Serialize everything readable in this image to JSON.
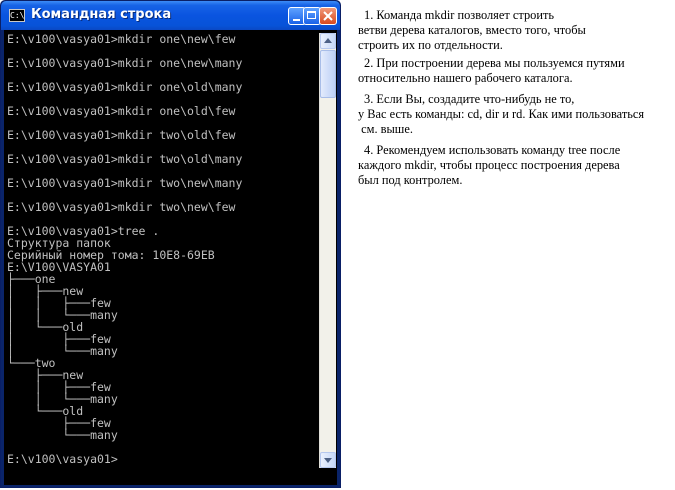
{
  "window": {
    "title": "Командная строка",
    "icon_label": "C:\\",
    "icon": "console-app-icon",
    "title_bar_color": "#0a54e0"
  },
  "console": {
    "text_color": "#c0c0c0",
    "background": "#000000",
    "lines": [
      "E:\\v100\\vasya01>mkdir one\\new\\few",
      "",
      "E:\\v100\\vasya01>mkdir one\\new\\many",
      "",
      "E:\\v100\\vasya01>mkdir one\\old\\many",
      "",
      "E:\\v100\\vasya01>mkdir one\\old\\few",
      "",
      "E:\\v100\\vasya01>mkdir two\\old\\few",
      "",
      "E:\\v100\\vasya01>mkdir two\\old\\many",
      "",
      "E:\\v100\\vasya01>mkdir two\\new\\many",
      "",
      "E:\\v100\\vasya01>mkdir two\\new\\few",
      "",
      "E:\\v100\\vasya01>tree .",
      "Структура папок",
      "Серийный номер тома: 10E8-69EB",
      "E:\\V100\\VASYA01",
      "├───one",
      "│   ├───new",
      "│   │   ├───few",
      "│   │   └───many",
      "│   └───old",
      "│       ├───few",
      "│       └───many",
      "└───two",
      "    ├───new",
      "    │   ├───few",
      "    │   └───many",
      "    └───old",
      "        ├───few",
      "        └───many",
      "",
      "E:\\v100\\vasya01>"
    ]
  },
  "notes": [
    {
      "lines": [
        "1. Команда mkdir позволяет строить",
        "ветви дерева каталогов, вместо того, чтобы",
        "строить их по отдельности."
      ]
    },
    {
      "lines": [
        "2. При построении дерева мы пользуемся путями",
        "относительно нашего рабочего каталога."
      ]
    },
    {
      "lines": [
        "3. Если Вы, создадите что-нибудь не то,",
        "у Вас есть команды: cd, dir и rd. Как ими пользоваться",
        " см. выше."
      ]
    },
    {
      "lines": [
        "4. Рекомендуем использовать команду tree после",
        "каждого mkdir, чтобы процесс построения дерева",
        "был под контролем."
      ]
    }
  ]
}
